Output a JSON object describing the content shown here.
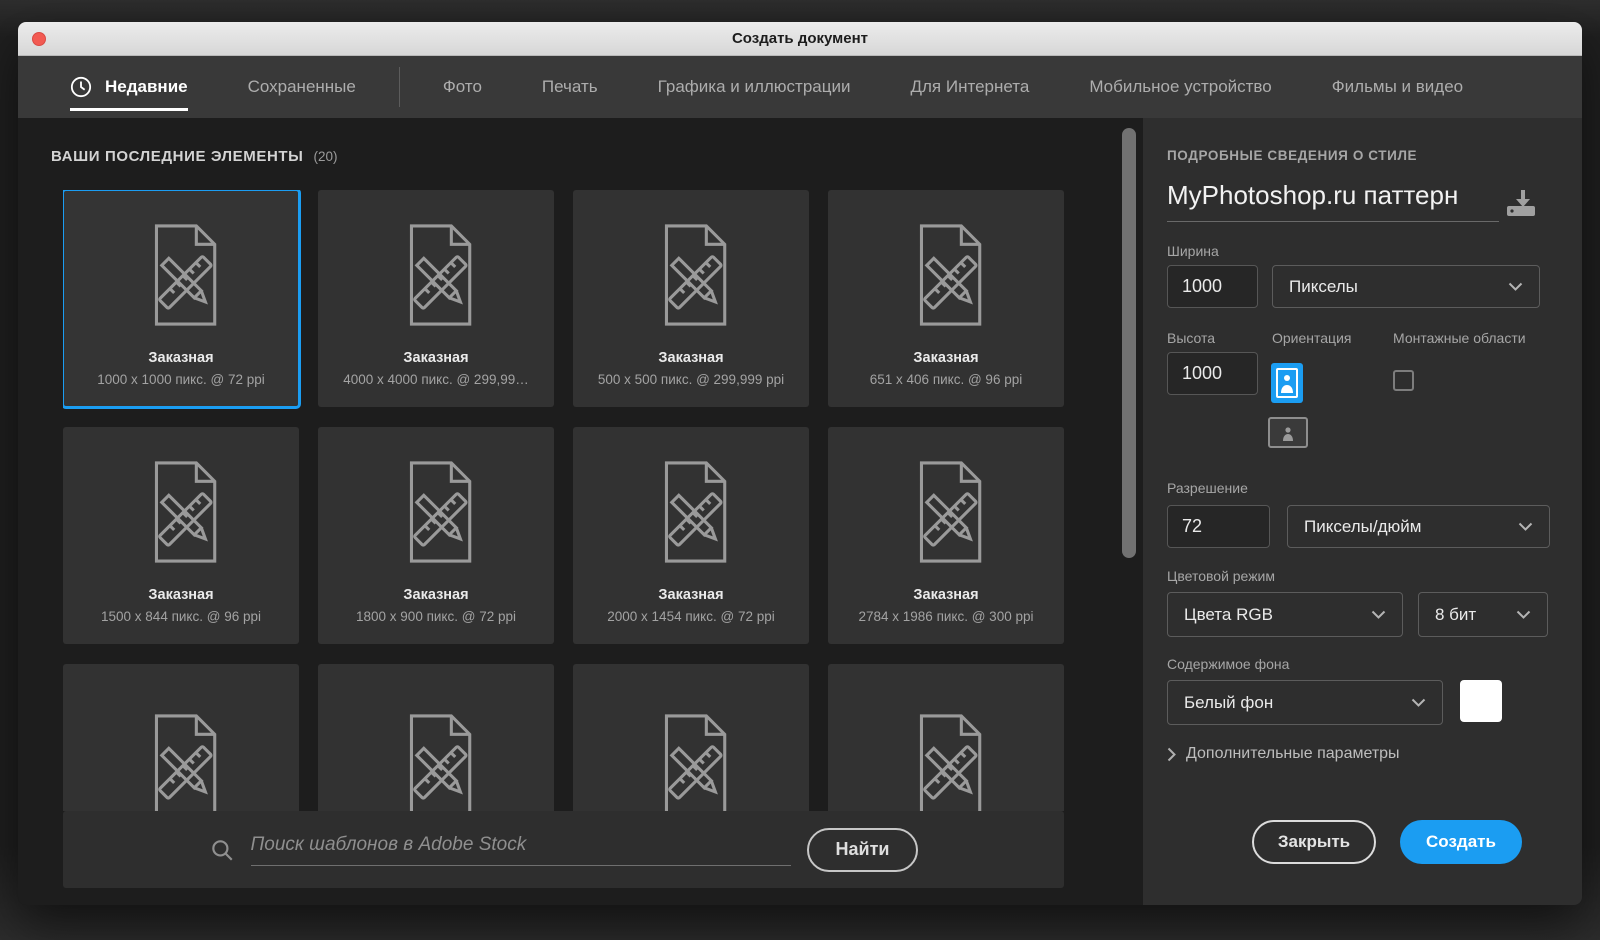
{
  "window": {
    "title": "Создать документ"
  },
  "tabs": [
    {
      "label": "Недавние",
      "active": true,
      "icon": "clock"
    },
    {
      "label": "Сохраненные"
    },
    {
      "label": "Фото",
      "divider_before": true
    },
    {
      "label": "Печать"
    },
    {
      "label": "Графика и иллюстрации"
    },
    {
      "label": "Для Интернета"
    },
    {
      "label": "Мобильное устройство"
    },
    {
      "label": "Фильмы и видео"
    }
  ],
  "recent": {
    "heading": "ВАШИ ПОСЛЕДНИЕ ЭЛЕМЕНТЫ",
    "count": "(20)",
    "items": [
      {
        "title": "Заказная",
        "spec": "1000 x 1000 пикс. @ 72 ppi",
        "selected": true
      },
      {
        "title": "Заказная",
        "spec": "4000 x 4000 пикс. @ 299,99…"
      },
      {
        "title": "Заказная",
        "spec": "500 x 500 пикс. @ 299,999 ppi"
      },
      {
        "title": "Заказная",
        "spec": "651 x 406 пикс. @ 96 ppi"
      },
      {
        "title": "Заказная",
        "spec": "1500 x 844 пикс. @ 96 ppi"
      },
      {
        "title": "Заказная",
        "spec": "1800 x 900 пикс. @ 72 ppi"
      },
      {
        "title": "Заказная",
        "spec": "2000 x 1454 пикс. @ 72 ppi"
      },
      {
        "title": "Заказная",
        "spec": "2784 x 1986 пикс. @ 300 ppi"
      },
      {
        "partial": true
      },
      {
        "partial": true
      },
      {
        "partial": true
      },
      {
        "partial": true
      }
    ]
  },
  "search": {
    "placeholder": "Поиск шаблонов в Adobe Stock",
    "button_label": "Найти"
  },
  "panel": {
    "heading": "ПОДРОБНЫЕ СВЕДЕНИЯ О СТИЛЕ",
    "doc_name": "MyPhotoshop.ru паттерн",
    "width_label": "Ширина",
    "width_value": "1000",
    "width_unit": "Пикселы",
    "height_label": "Высота",
    "height_value": "1000",
    "orientation_label": "Ориентация",
    "artboards_label": "Монтажные области",
    "resolution_label": "Разрешение",
    "resolution_value": "72",
    "resolution_unit": "Пикселы/дюйм",
    "color_mode_label": "Цветовой режим",
    "color_mode_value": "Цвета RGB",
    "bit_depth_value": "8 бит",
    "background_label": "Содержимое фона",
    "background_value": "Белый фон",
    "advanced_label": "Дополнительные параметры",
    "close_button": "Закрыть",
    "create_button": "Создать"
  },
  "colors": {
    "accent_blue": "#1b9df2",
    "titlebar_close_red": "#f25a52",
    "background_swatch": "#ffffff"
  }
}
